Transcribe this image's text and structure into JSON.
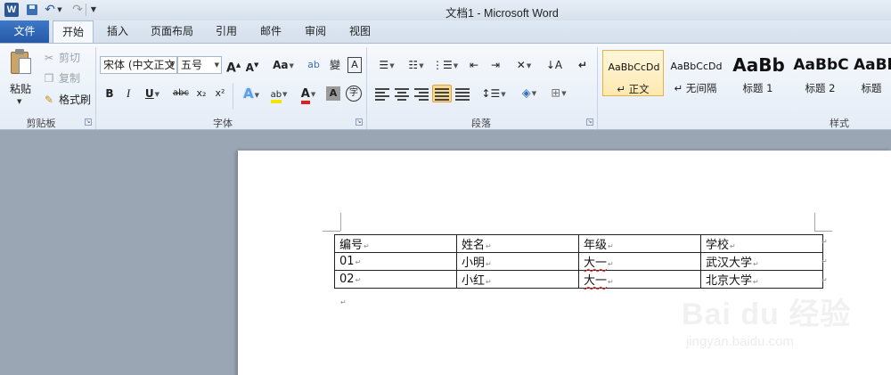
{
  "window": {
    "title": "文档1 - Microsoft Word"
  },
  "qat": {
    "logo": "W",
    "undo_icon": "↶",
    "redo_icon": "↷"
  },
  "tabs": [
    {
      "label": "文件"
    },
    {
      "label": "开始"
    },
    {
      "label": "插入"
    },
    {
      "label": "页面布局"
    },
    {
      "label": "引用"
    },
    {
      "label": "邮件"
    },
    {
      "label": "审阅"
    },
    {
      "label": "视图"
    }
  ],
  "clipboard": {
    "paste_label": "粘贴",
    "cut_label": "剪切",
    "copy_label": "复制",
    "format_painter_label": "格式刷",
    "group_label": "剪贴板"
  },
  "font": {
    "font_name": "宋体 (中文正文",
    "font_size": "五号",
    "grow_label": "A",
    "shrink_label": "A",
    "case_label": "Aa",
    "bold": "B",
    "italic": "I",
    "underline": "U",
    "strike": "abc",
    "subscript": "x₂",
    "superscript": "x²",
    "text_effect": "A",
    "highlight": "ab",
    "font_color": "A",
    "char_shading": "A",
    "enclose": "字",
    "group_label": "字体",
    "highlight_color": "#f5e400",
    "font_color_value": "#e02020"
  },
  "paragraph": {
    "group_label": "段落"
  },
  "styles": {
    "group_label": "样式",
    "items": [
      {
        "sample": "AaBbCcDd",
        "name": "↵ 正文"
      },
      {
        "sample": "AaBbCcDd",
        "name": "↵ 无间隔"
      },
      {
        "sample": "AaBb",
        "name": "标题 1"
      },
      {
        "sample": "AaBbC",
        "name": "标题 2"
      },
      {
        "sample": "AaBl",
        "name": "标题"
      }
    ]
  },
  "table": {
    "rows": [
      [
        "编号",
        "姓名",
        "年级",
        "学校"
      ],
      [
        "01",
        "小明",
        "大一",
        "武汉大学"
      ],
      [
        "02",
        "小红",
        "大一",
        "北京大学"
      ]
    ]
  },
  "watermark": {
    "main": "Bai du 经验",
    "sub": "jingyan.baidu.com"
  }
}
